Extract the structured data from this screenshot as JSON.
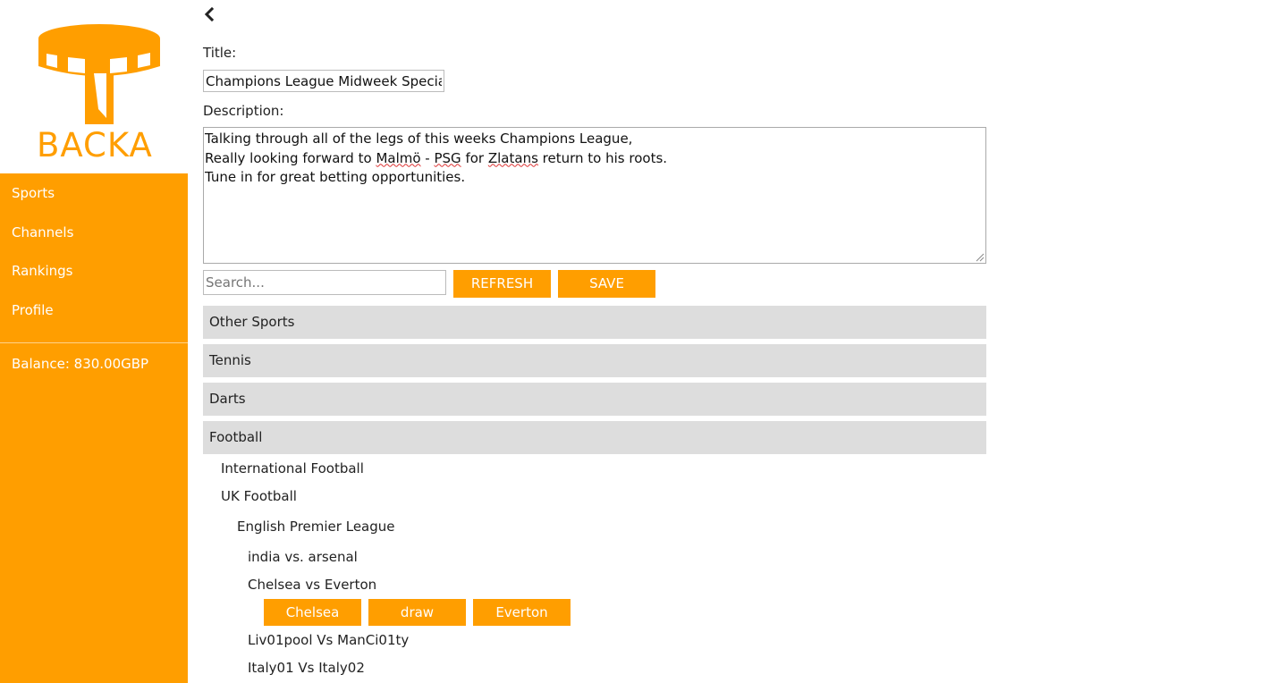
{
  "brand": {
    "name": "BACKA",
    "color": "#ff9e00"
  },
  "sidebar": {
    "items": [
      {
        "label": "Sports"
      },
      {
        "label": "Channels"
      },
      {
        "label": "Rankings"
      },
      {
        "label": "Profile"
      }
    ],
    "balance": "Balance: 830.00GBP"
  },
  "form": {
    "title_label": "Title:",
    "title_value": "Champions League Midweek Special",
    "description_label": "Description:",
    "description_lines": [
      [
        "Talking through all of the legs of this weeks Champions League,"
      ],
      [
        "Really looking forward to ",
        "Malmö",
        " - ",
        "PSG",
        " for ",
        "Zlatans",
        " return to his roots."
      ],
      [
        "Tune in for great betting opportunities."
      ]
    ],
    "search_placeholder": "Search...",
    "refresh_label": "REFRESH",
    "save_label": "SAVE"
  },
  "categories": [
    {
      "label": "Other Sports"
    },
    {
      "label": "Tennis"
    },
    {
      "label": "Darts"
    },
    {
      "label": "Football"
    }
  ],
  "football_tree": {
    "international": "International Football",
    "uk": "UK Football",
    "league": "English Premier League",
    "matches": [
      {
        "label": "india vs. arsenal"
      },
      {
        "label": "Chelsea vs Everton",
        "options": [
          "Chelsea",
          "draw",
          "Everton"
        ]
      },
      {
        "label": "Liv01pool Vs ManCi01ty"
      },
      {
        "label": "Italy01 Vs Italy02"
      }
    ]
  },
  "icons": {
    "back": "chevron-left-icon",
    "logo": "backa-logo-icon",
    "resize": "resize-grip-icon"
  }
}
